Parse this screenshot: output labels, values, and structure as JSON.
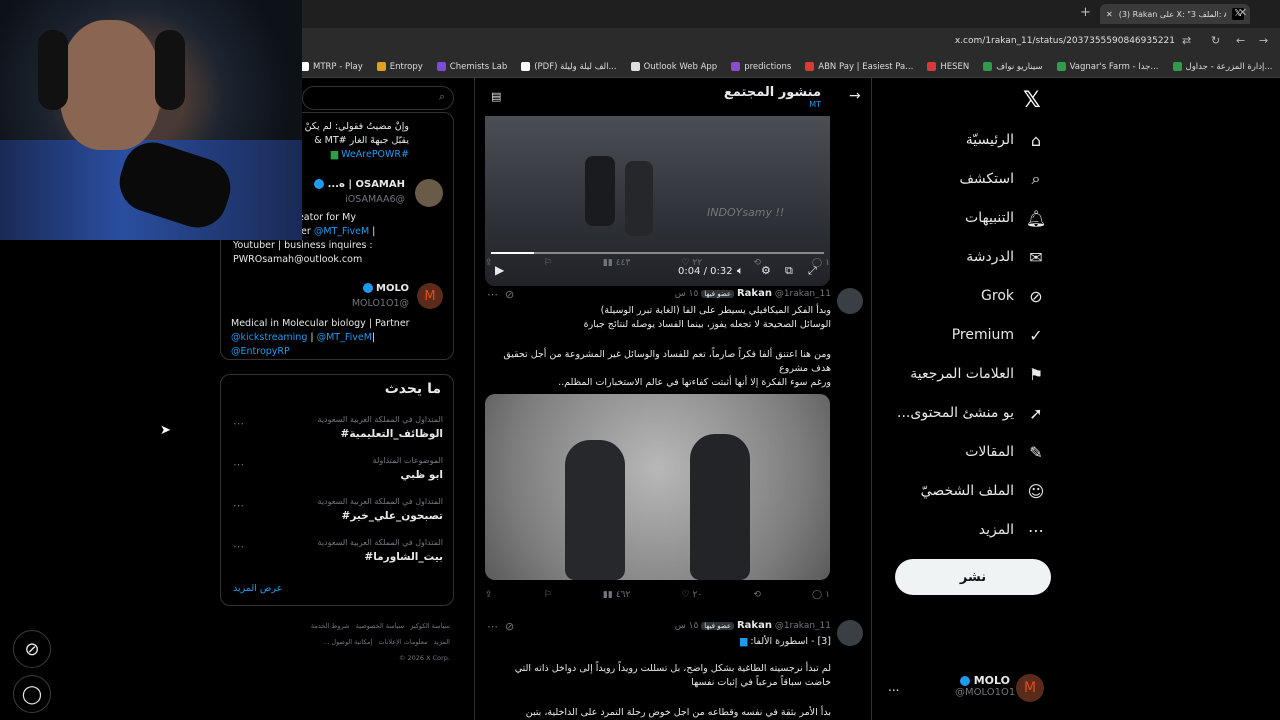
{
  "browser": {
    "tab_title": "(3) Rakan على X: \"3 الملف: ALPH",
    "url": "x.com/1rakan_11/status/2037355590846935221",
    "new_tab": "+",
    "bookmarks": [
      {
        "label": "MTRP - Play",
        "color": "#ffffff"
      },
      {
        "label": "Entropy",
        "color": "#e0a020"
      },
      {
        "label": "Chemists Lab",
        "color": "#7a4cd8"
      },
      {
        "label": "(PDF) الف ليلة وليلة...",
        "color": "#ffffff"
      },
      {
        "label": "Outlook Web App",
        "color": "#e0e0e0"
      },
      {
        "label": "predictions",
        "color": "#8a4cc8"
      },
      {
        "label": "ABN Pay | Easiest Pa...",
        "color": "#d83a3a"
      },
      {
        "label": "HESEN",
        "color": "#d83a3a"
      },
      {
        "label": "سيناريو نواف",
        "color": "#2e9c4a"
      },
      {
        "label": "Vagnar's Farm - جدا...",
        "color": "#2e9c4a"
      },
      {
        "label": "إدارة المزرعة - جداول...",
        "color": "#2e9c4a"
      }
    ]
  },
  "nav": {
    "items": [
      {
        "label": "الرئيسيّة",
        "icon": "home-icon",
        "glyph": "⌂"
      },
      {
        "label": "استكشف",
        "icon": "search-icon",
        "glyph": "⌕"
      },
      {
        "label": "التنبيهات",
        "icon": "bell-icon",
        "glyph": "🔔︎"
      },
      {
        "label": "الدردشة",
        "icon": "mail-icon",
        "glyph": "✉"
      },
      {
        "label": "Grok",
        "icon": "grok-icon",
        "glyph": "⊘"
      },
      {
        "label": "Premium",
        "icon": "premium-icon",
        "glyph": "✓"
      },
      {
        "label": "العلامات المرجعية",
        "icon": "bookmark-icon",
        "glyph": "⚑"
      },
      {
        "label": "...يو منشئ المحتوى",
        "icon": "rocket-icon",
        "glyph": "➚"
      },
      {
        "label": "المقالات",
        "icon": "article-icon",
        "glyph": "✎"
      },
      {
        "label": "الملف الشخصيّ",
        "icon": "profile-icon",
        "glyph": "☺"
      },
      {
        "label": "المزيد",
        "icon": "more-icon",
        "glyph": "⋯"
      }
    ],
    "post_label": "نشر",
    "account": {
      "name": "MOLO",
      "handle": "@MOLO1O1",
      "more": "..."
    }
  },
  "main": {
    "title": "منشور المجتمع",
    "subtitle": "MT",
    "video": {
      "time": "0:04 / 0:32",
      "watermark": "INDOYsamy !!"
    },
    "actions1": {
      "reply": "١",
      "repost": "",
      "like": "٢٢",
      "views": "٤٤٣"
    },
    "tweet1": {
      "name": "Rakan",
      "handle": "@1rakan_11",
      "badge": "عضو فيها",
      "time": "١٥ س",
      "para1": "وبدأ الفكر الميكافيلي يسيطر على الفا (الغاية تبرر الوسيلة)\nالوسائل الصحيحة لا تجعله يفوز، بينما الفساد يوصله لنتائج جبارة",
      "para2": "ومن هنا اعتنق ألفا فكراً صارماً، تعم للفساد والوسائل غير المشروعة من أجل تحقيق هدف مشروع\nورغم سوء الفكرة إلا أنها أثبتت كفاءتها في عالم الاستخبارات المظلم.."
    },
    "actions2": {
      "reply": "١",
      "repost": "",
      "like": "٢٠",
      "views": "٤٦٢"
    },
    "tweet2": {
      "name": "Rakan",
      "handle": "@1rakan_11",
      "badge": "عضو فيها",
      "time": "١٥ س",
      "title": "[3] - اسطورة الألفا:",
      "para1": "لم تبدأ نرجسيته الطاغية بشكل واضح، بل تسللت رويداً رويداً إلى دواخل ذاته التي خاضت سباقاً مرعباً في إثبات نفسها",
      "para2": "بدأ الأمر بثقة في نفسه وقطاعه من اجل خوض رحلة التمرد على الداخلية، بتبن"
    }
  },
  "left": {
    "profiles": [
      {
        "text1": "وإنْ مضيتُ فقولي: لم يكنْ",
        "text2": "يقبّل جبهةَ الغار #MT &",
        "tag": "#WeArePOWR"
      },
      {
        "name": "OSAMAH | ه...",
        "handle": "@iOSAMAA6",
        "bio1": "ent Creator for My",
        "bio2": "der",
        "link": "@MT_FiveM",
        "bio3": "Youtuber | business inquires :",
        "bio4": "PWROsamah@outlook.com"
      },
      {
        "name": "MOLO",
        "handle": "@MOLO1O1",
        "bio1": "Medical in Molecular biology | Partner",
        "link1": "@kickstreaming",
        "link2": "@MT_FiveM",
        "link3": "@EntropyRP"
      }
    ],
    "trending_title": "ما يحدث",
    "trends": [
      {
        "meta": "المتداول في المملكة العربية السعودية",
        "tag": "#الوظائف_التعليمية"
      },
      {
        "meta": "الموضوعات المتداولة",
        "tag": "ابو ظبي"
      },
      {
        "meta": "المتداول في المملكة العربية السعودية",
        "tag": "#تصبحون_علي_خير"
      },
      {
        "meta": "المتداول في المملكة العربية السعودية",
        "tag": "#بيت_الشاورما"
      }
    ],
    "show_more": "عرض المزيد",
    "footer": [
      "شروط الخدمة",
      "سياسة الخصوصية",
      "سياسة الكوكيز",
      "إمكانية الوصول",
      "معلومات الإعلانات",
      "... المزيد",
      "© 2026 X Corp."
    ]
  }
}
